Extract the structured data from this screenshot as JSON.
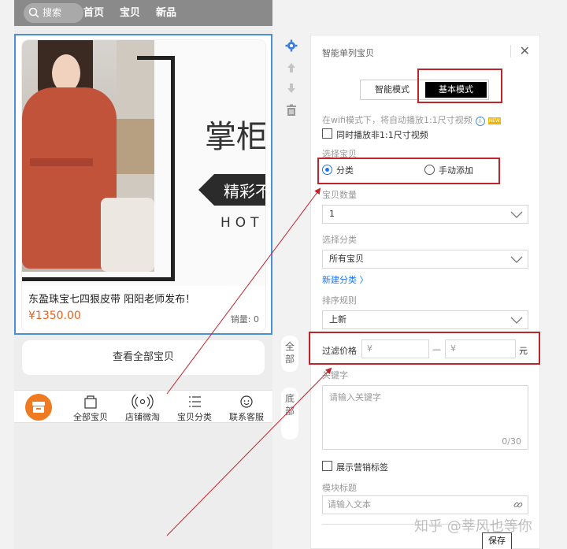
{
  "phone": {
    "search_label": "搜索",
    "nav": [
      "首页",
      "宝贝",
      "新品"
    ],
    "banner": {
      "title": "掌柜",
      "subtitle": "精彩不",
      "english": "HOT"
    },
    "product": {
      "name": "东盈珠宝七四狠皮带 阳阳老师发布！",
      "price": "¥1350.00",
      "sales": "销量: 0"
    },
    "view_all": "查看全部宝贝",
    "tabs": [
      "全部宝贝",
      "店铺微淘",
      "宝贝分类",
      "联系客服"
    ]
  },
  "side_tabs": {
    "all": "全部",
    "bottom": "底部"
  },
  "panel": {
    "title": "智能单列宝贝",
    "modes": {
      "smart": "智能模式",
      "basic": "基本模式"
    },
    "wifi_note": "在wifi模式下，将自动播放1:1尺寸视频",
    "new_badge": "NEW",
    "play_non_square": "同时播放非1:1尺寸视频",
    "select_items_label": "选择宝贝",
    "radio_category": "分类",
    "radio_manual": "手动添加",
    "count_label": "宝贝数量",
    "count_value": "1",
    "category_label": "选择分类",
    "category_value": "所有宝贝",
    "new_category_link": "新建分类 〉",
    "sort_label": "排序规则",
    "sort_value": "上新",
    "price_filter_label": "过滤价格",
    "price_min_placeholder": "¥",
    "price_dash": "—",
    "price_max_placeholder": "¥",
    "price_unit": "元",
    "keyword_label": "关键字",
    "keyword_placeholder": "请输入关键字",
    "keyword_counter": "0/30",
    "show_marketing_tag": "展示营销标签",
    "module_title_label": "模块标题",
    "module_title_placeholder": "请输入文本",
    "save": "保存"
  },
  "watermark": "知乎 @莘风也等你",
  "colors": {
    "accent_red": "#c0242b",
    "link_blue": "#1677ff",
    "price_orange": "#e5621d",
    "selection_blue": "#4a90d9"
  }
}
